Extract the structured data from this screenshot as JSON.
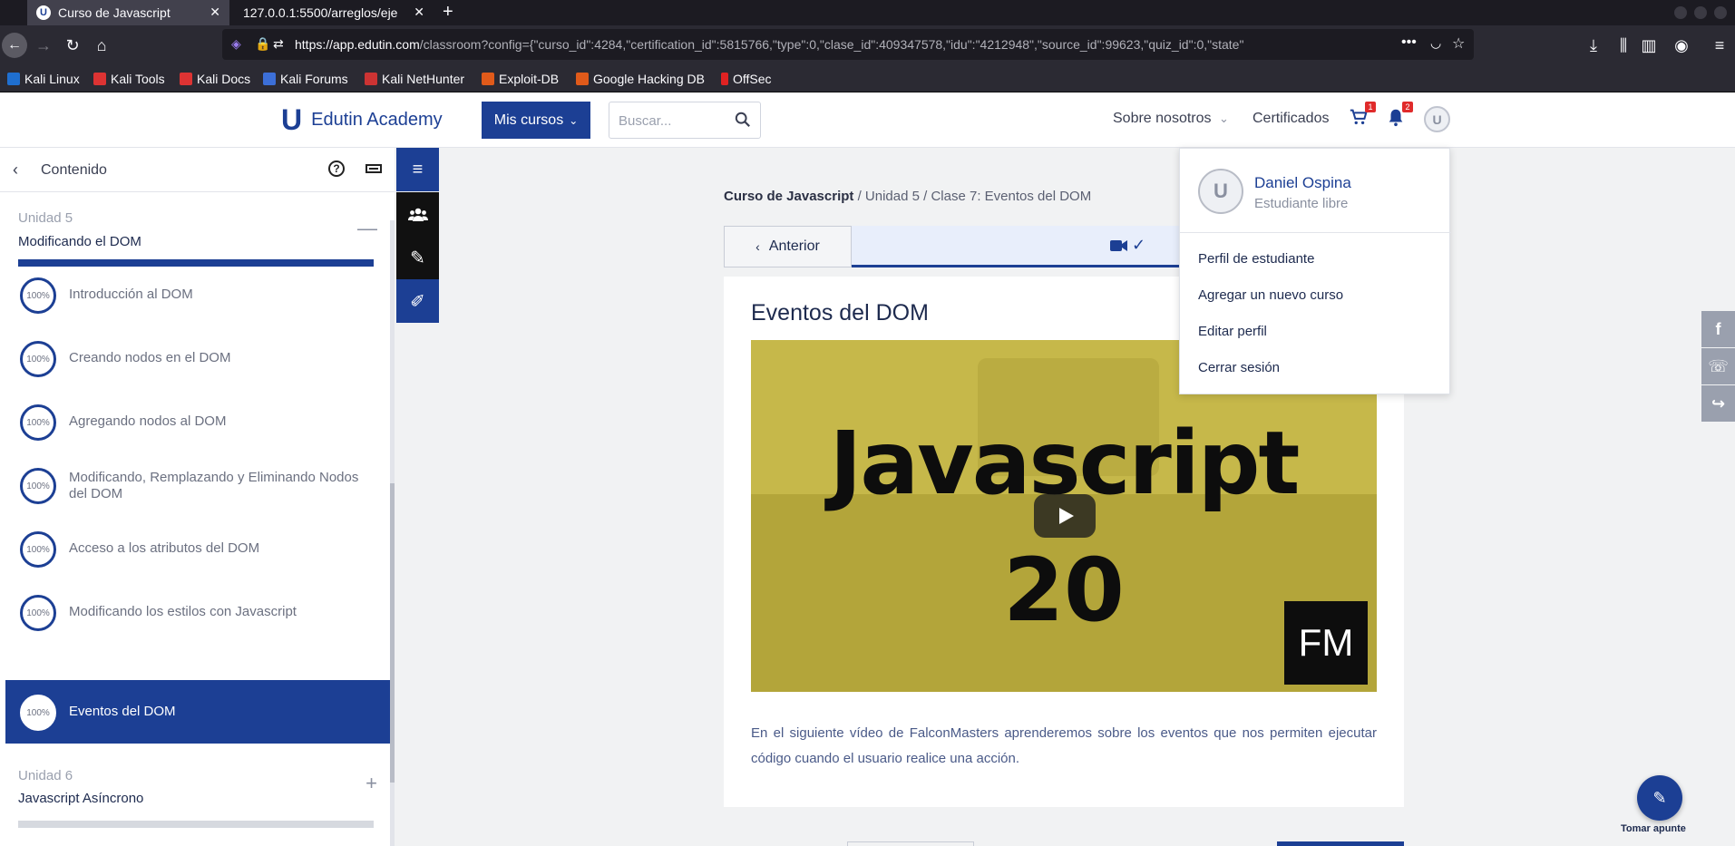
{
  "browser": {
    "tabs": [
      {
        "label": "Curso de Javascript",
        "favicon": "U"
      },
      {
        "label": "127.0.0.1:5500/arreglos/eje"
      }
    ],
    "url_host": "https://app.edutin.com",
    "url_rest": "/classroom?config={\"curso_id\":4284,\"certification_id\":5815766,\"type\":0,\"clase_id\":409347578,\"idu\":\"4212948\",\"source_id\":99623,\"quiz_id\":0,\"state\"",
    "bookmarks": [
      "Kali Linux",
      "Kali Tools",
      "Kali Docs",
      "Kali Forums",
      "Kali NetHunter",
      "Exploit-DB",
      "Google Hacking DB",
      "OffSec"
    ]
  },
  "header": {
    "brand_mark": "U",
    "brand": "Edutin Academy",
    "mis_cursos": "Mis cursos",
    "search_placeholder": "Buscar...",
    "about": "Sobre nosotros",
    "certificados": "Certificados",
    "cart_badge": "1",
    "bell_badge": "2"
  },
  "sidebar": {
    "title": "Contenido",
    "unit5": {
      "sub": "Unidad 5",
      "name": "Modificando el DOM",
      "toggle": "—"
    },
    "lessons": [
      {
        "pct": "100%",
        "title": "Introducción al DOM"
      },
      {
        "pct": "100%",
        "title": "Creando nodos en el DOM"
      },
      {
        "pct": "100%",
        "title": "Agregando nodos al DOM"
      },
      {
        "pct": "100%",
        "title": "Modificando, Remplazando y Eliminando Nodos del DOM"
      },
      {
        "pct": "100%",
        "title": "Acceso a los atributos del DOM"
      },
      {
        "pct": "100%",
        "title": "Modificando los estilos con Javascript"
      },
      {
        "pct": "100%",
        "title": "Eventos del DOM"
      }
    ],
    "unit6": {
      "sub": "Unidad 6",
      "name": "Javascript Asíncrono",
      "toggle": "+"
    }
  },
  "breadcrumb": {
    "course": "Curso de Javascript",
    "rest": " / Unidad 5 / Clase 7: Eventos del DOM"
  },
  "nav": {
    "prev": "Anterior"
  },
  "lesson": {
    "title": "Eventos del DOM",
    "video_title_line1": "Javascript",
    "video_title_line2": "20",
    "video_badge": "FM",
    "description": "En el siguiente vídeo de FalconMasters aprenderemos sobre los eventos que nos permiten ejecutar código cuando el usuario realice una acción."
  },
  "profile_menu": {
    "avatar_mark": "U",
    "name": "Daniel Ospina",
    "role": "Estudiante libre",
    "items": [
      "Perfil de estudiante",
      "Agregar un nuevo curso",
      "Editar perfil",
      "Cerrar sesión"
    ]
  },
  "fab_label": "Tomar apunte",
  "colors": {
    "primary": "#1c3f94",
    "badge": "#e02b2b"
  }
}
